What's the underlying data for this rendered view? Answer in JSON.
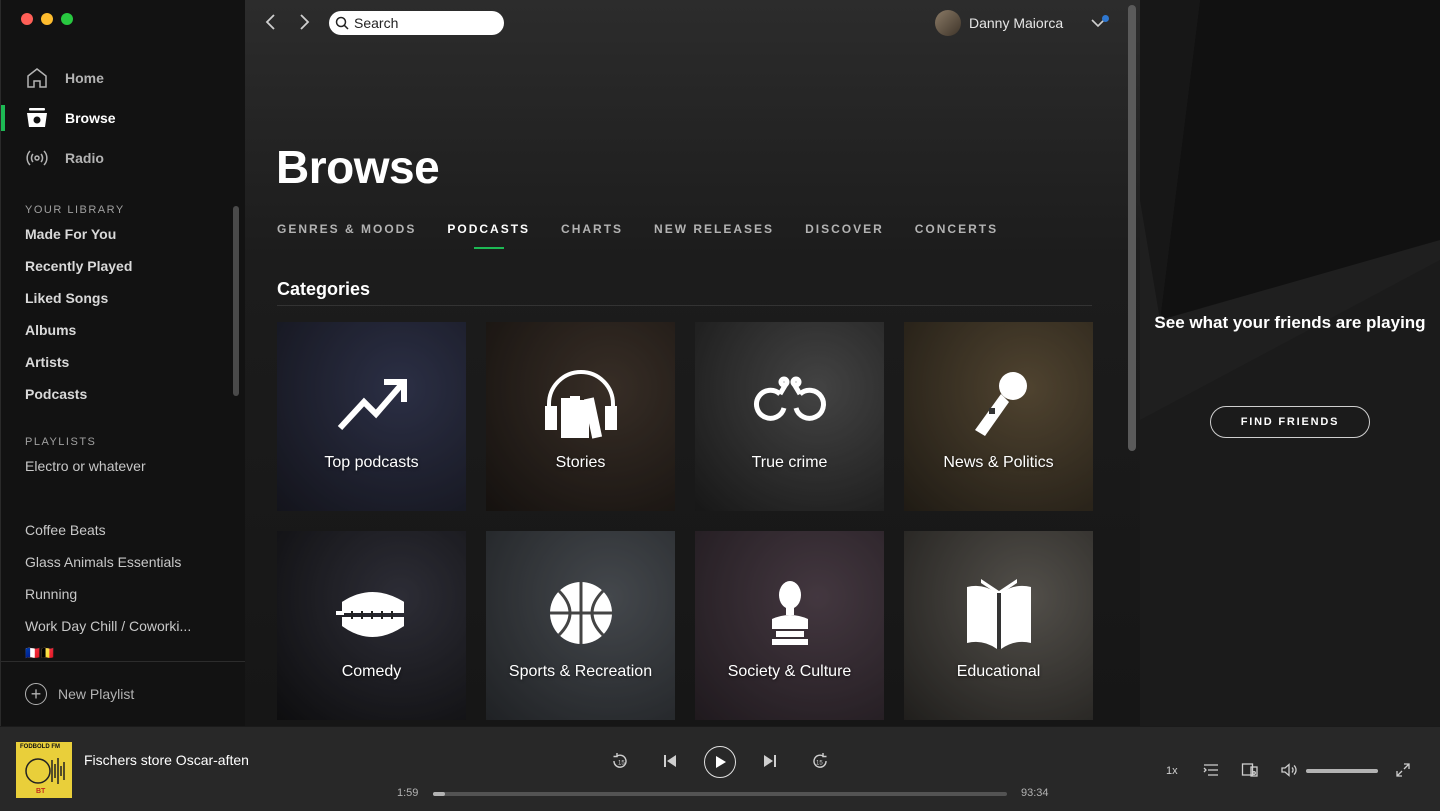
{
  "window": {
    "traffic_colors": [
      "#ff5f57",
      "#febc2e",
      "#28c840"
    ]
  },
  "sidebar": {
    "nav": [
      {
        "label": "Home",
        "icon": "home-icon"
      },
      {
        "label": "Browse",
        "icon": "browse-icon",
        "active": true
      },
      {
        "label": "Radio",
        "icon": "radio-icon"
      }
    ],
    "library_heading": "YOUR LIBRARY",
    "library": [
      "Made For You",
      "Recently Played",
      "Liked Songs",
      "Albums",
      "Artists",
      "Podcasts"
    ],
    "playlists_heading": "PLAYLISTS",
    "playlists": [
      "Electro or whatever",
      "Coffee Beats",
      "Glass Animals Essentials",
      "Running",
      "Work Day Chill / Coworki...",
      "🇫🇷🇧🇪"
    ],
    "new_playlist": "New Playlist"
  },
  "topbar": {
    "search_placeholder": "Search",
    "user_name": "Danny Maiorca"
  },
  "main": {
    "title": "Browse",
    "tabs": [
      {
        "label": "GENRES & MOODS"
      },
      {
        "label": "PODCASTS",
        "active": true
      },
      {
        "label": "CHARTS"
      },
      {
        "label": "NEW RELEASES"
      },
      {
        "label": "DISCOVER"
      },
      {
        "label": "CONCERTS"
      }
    ],
    "section_title": "Categories",
    "categories": [
      {
        "label": "Top podcasts",
        "icon": "trending-up-icon",
        "colors": [
          "#3a3f5c",
          "#1a1b25"
        ]
      },
      {
        "label": "Stories",
        "icon": "headphones-books-icon",
        "colors": [
          "#4a3d33",
          "#1c1714"
        ]
      },
      {
        "label": "True crime",
        "icon": "handcuffs-icon",
        "colors": [
          "#5a5a5a",
          "#1f1f1f"
        ]
      },
      {
        "label": "News & Politics",
        "icon": "microphone-icon",
        "colors": [
          "#6a5a40",
          "#2a241b"
        ]
      },
      {
        "label": "Comedy",
        "icon": "wind-up-teeth-icon",
        "colors": [
          "#3c3c48",
          "#121214"
        ]
      },
      {
        "label": "Sports & Recreation",
        "icon": "basketball-icon",
        "colors": [
          "#5b6066",
          "#2a2d31"
        ]
      },
      {
        "label": "Society & Culture",
        "icon": "bust-icon",
        "colors": [
          "#5a4a55",
          "#2a2228"
        ]
      },
      {
        "label": "Educational",
        "icon": "open-book-icon",
        "colors": [
          "#6e6a63",
          "#2b2926"
        ]
      }
    ]
  },
  "friends": {
    "text": "See what your friends are playing",
    "button": "FIND FRIENDS"
  },
  "player": {
    "cover_top": "FODBOLD FM",
    "cover_bottom": "BT",
    "track": "Fischers store Oscar-aften",
    "time_current": "1:59",
    "time_total": "93:34",
    "progress": 0.021,
    "speed": "1x",
    "volume": 1.0,
    "accent": "#1db954"
  }
}
